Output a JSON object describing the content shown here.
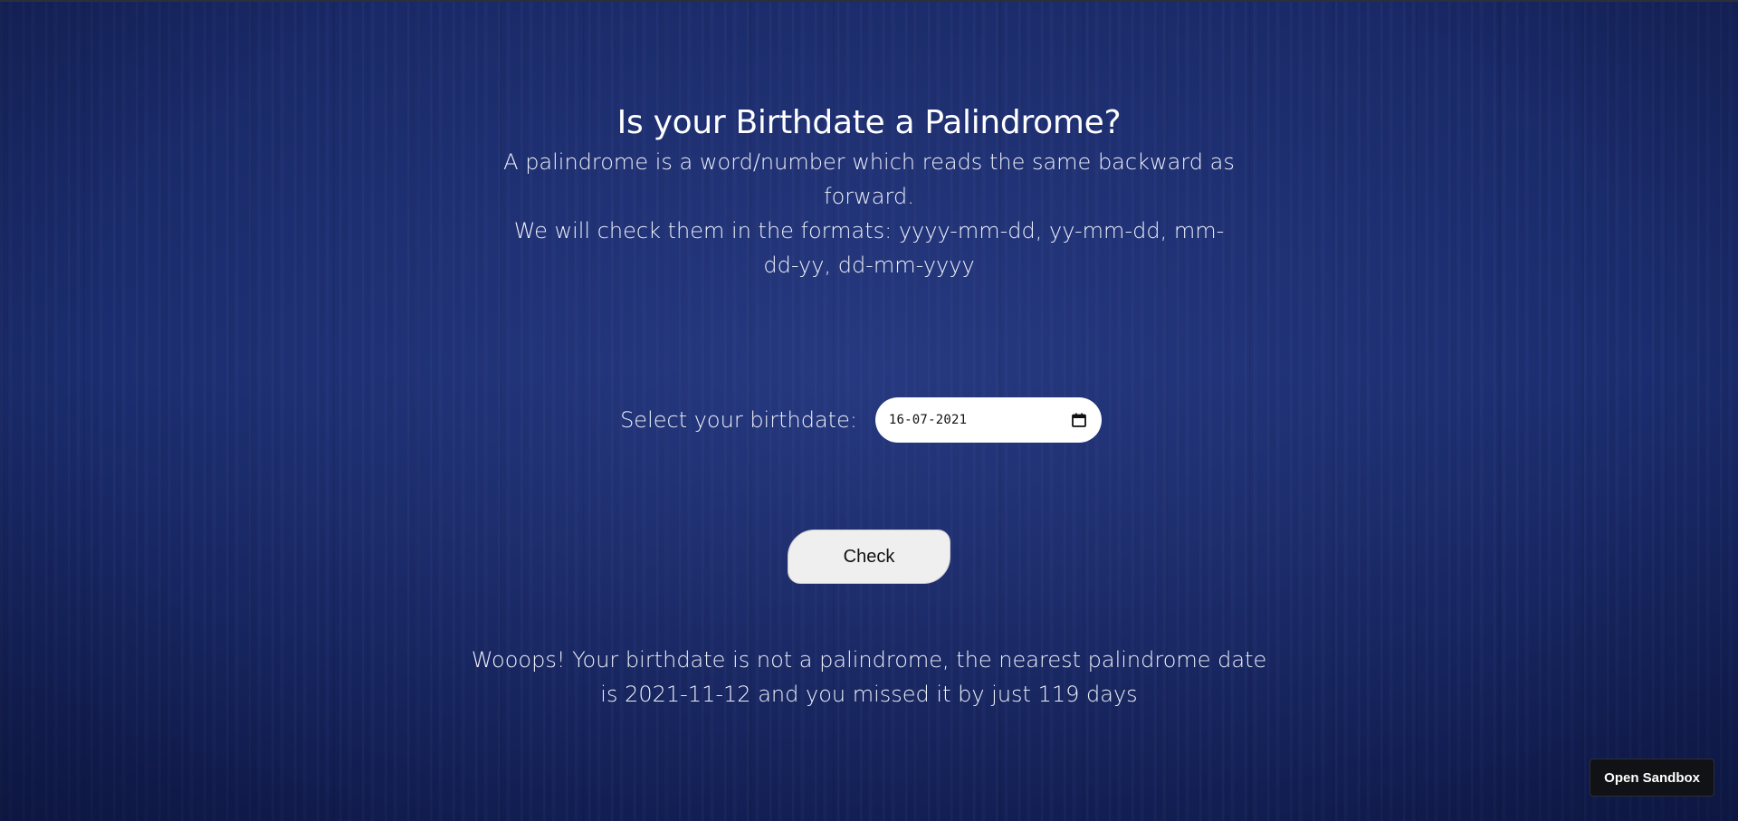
{
  "header": {
    "title": "Is your Birthdate a Palindrome?",
    "description_line1": "A palindrome is a word/number which reads the same backward as forward.",
    "description_line2": "We will check them in the formats: yyyy-mm-dd, yy-mm-dd, mm-dd-yy, dd-mm-yyyy"
  },
  "form": {
    "label": "Select your birthdate:",
    "date_value": "16-07-2021",
    "calendar_icon": "calendar-icon"
  },
  "actions": {
    "check_label": "Check"
  },
  "result": {
    "message": "Wooops! Your birthdate is not a palindrome, the nearest palindrome date is 2021-11-12 and you missed it by just 119 days"
  },
  "sandbox": {
    "label": "Open Sandbox"
  },
  "colors": {
    "background": "#17255f",
    "text": "#eef0fa",
    "button": "#efefef",
    "sandbox_button": "#111216"
  }
}
